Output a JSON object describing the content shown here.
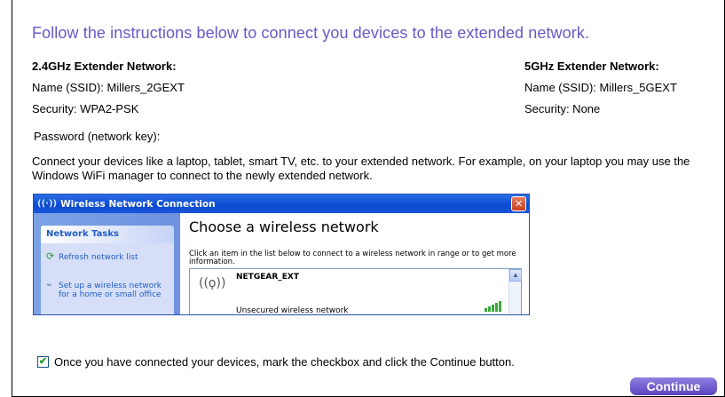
{
  "heading": "Follow the instructions below to connect you devices to the extended network.",
  "network_24": {
    "title": "2.4GHz Extender Network:",
    "name_line": "Name (SSID):  Millers_2GEXT",
    "security_line": "Security: WPA2-PSK",
    "password_line": "Password (network key):"
  },
  "network_5": {
    "title": "5GHz Extender Network:",
    "name_line": "Name (SSID):  Millers_5GEXT",
    "security_line": "Security: None"
  },
  "instructions": "Connect your devices like a laptop, tablet, smart TV, etc. to your extended network. For example, on your laptop you may use the Windows WiFi manager to connect to the newly extended network.",
  "screenshot": {
    "window_title": "Wireless Network Connection",
    "close_glyph": "✕",
    "tasks_header": "Network Tasks",
    "task_refresh": "Refresh network list",
    "task_setup_1": "Set up a wireless network",
    "task_setup_2": "for a home or small office",
    "main_heading": "Choose a wireless network",
    "main_instructions": "Click an item in the list below to connect to a wireless network in range or to get more information.",
    "network_name": "NETGEAR_EXT",
    "network_security": "Unsecured wireless network",
    "signal_bars": 5
  },
  "checkbox": {
    "checked": true,
    "label": "Once you have connected your devices, mark the checkbox and click the Continue button."
  },
  "continue_label": "Continue",
  "colors": {
    "heading": "#6b57c8",
    "button": "#5a43c0",
    "checkmark": "#21a121"
  }
}
